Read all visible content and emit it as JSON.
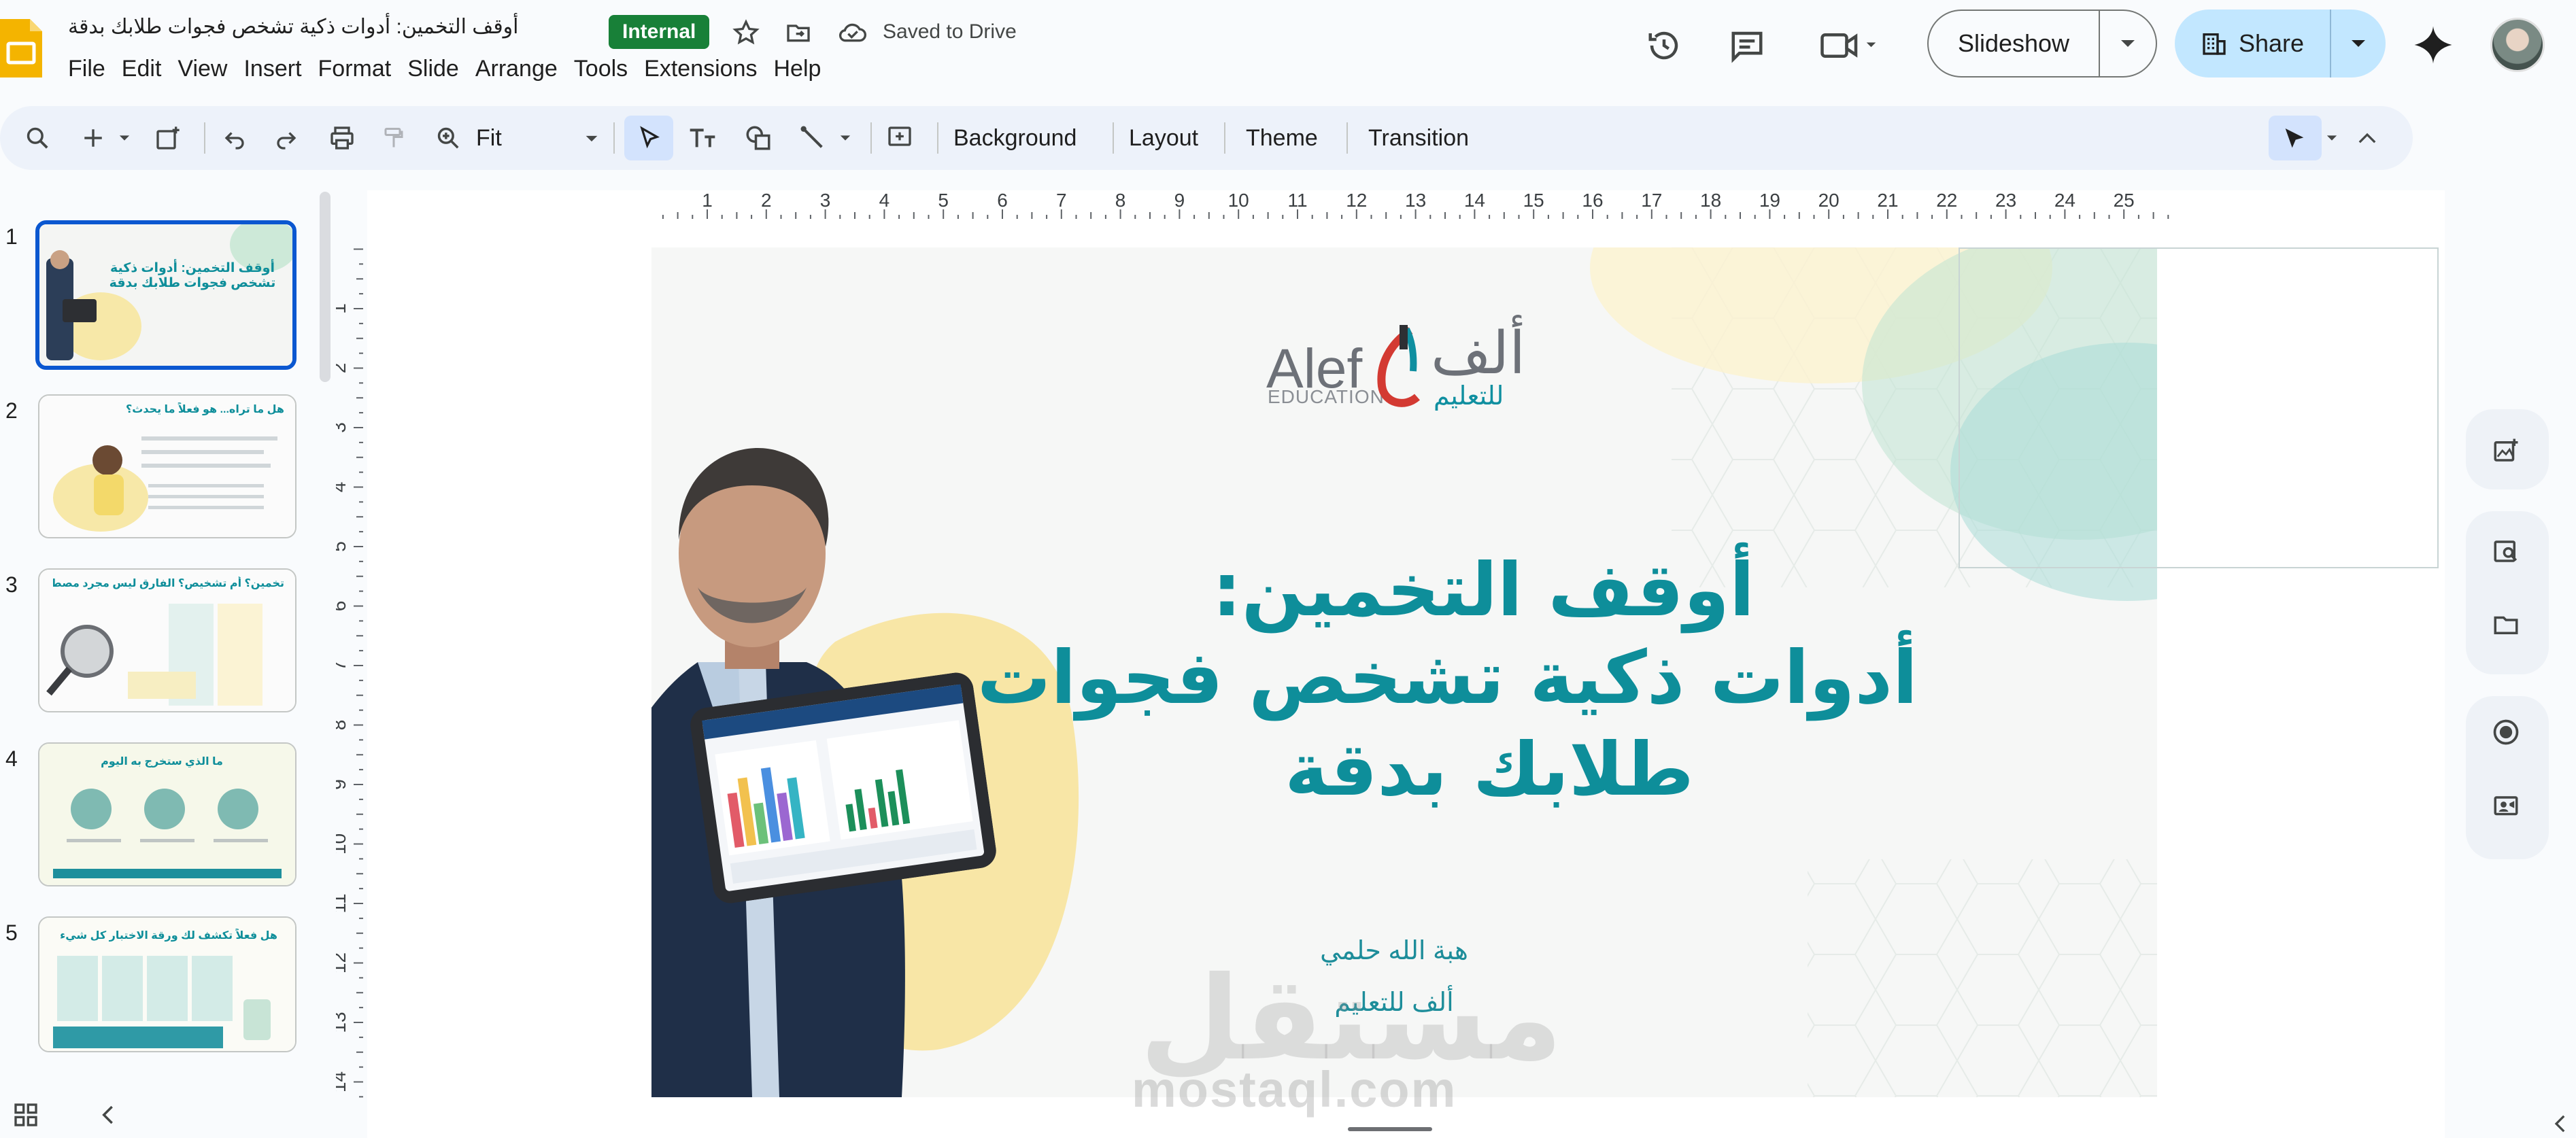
{
  "header": {
    "doc_title": "أوقف التخمين: أدوات ذكية تشخص فجوات طلابك بدقة",
    "badge": "Internal",
    "saved_status": "Saved to Drive",
    "menu": [
      "File",
      "Edit",
      "View",
      "Insert",
      "Format",
      "Slide",
      "Arrange",
      "Tools",
      "Extensions",
      "Help"
    ],
    "slideshow_label": "Slideshow",
    "share_label": "Share"
  },
  "toolbar": {
    "zoom": "Fit",
    "background": "Background",
    "layout": "Layout",
    "theme": "Theme",
    "transition": "Transition"
  },
  "filmstrip": {
    "slides": [
      {
        "number": "1",
        "title": "أوقف التخمين: أدوات ذكية تشخص فجوات طلابك بدقة"
      },
      {
        "number": "2",
        "title": "هل ما تراه... هو فعلاً ما يحدث؟"
      },
      {
        "number": "3",
        "title": "تخمين؟ أم تشخيص؟ الفارق ليس مجرد مصطلح"
      },
      {
        "number": "4",
        "title": "ما الذي ستخرج به اليوم"
      },
      {
        "number": "5",
        "title": "هل فعلاً تكشف لك ورقة الاختبار كل شيء؟"
      }
    ]
  },
  "ruler": {
    "h": [
      "1",
      "2",
      "3",
      "4",
      "5",
      "6",
      "7",
      "8",
      "9",
      "10",
      "11",
      "12",
      "13",
      "14",
      "15",
      "16",
      "17",
      "18",
      "19",
      "20",
      "21",
      "22",
      "23",
      "24",
      "25"
    ],
    "v": [
      "1",
      "2",
      "3",
      "4",
      "5",
      "6",
      "7",
      "8",
      "9",
      "10",
      "11",
      "12",
      "13",
      "14"
    ]
  },
  "slide": {
    "logo_latin": "Alef",
    "logo_education": "EDUCATION",
    "logo_arabic": "ألف",
    "logo_arabic_sub": "للتعليم",
    "title_line1": "أوقف التخمين:",
    "title_line2": "أدوات ذكية تشخص فجوات",
    "title_line3": "طلابك بدقة",
    "author": "هبة الله حلمي",
    "organization": "ألف للتعليم",
    "watermark_ar": "مستقل",
    "watermark_en": "mostaql.com"
  },
  "colors": {
    "accent_teal": "#0e8e9a",
    "share_bg": "#c2e7ff",
    "internal_badge": "#188038",
    "selection_blue": "#0b57d0"
  }
}
